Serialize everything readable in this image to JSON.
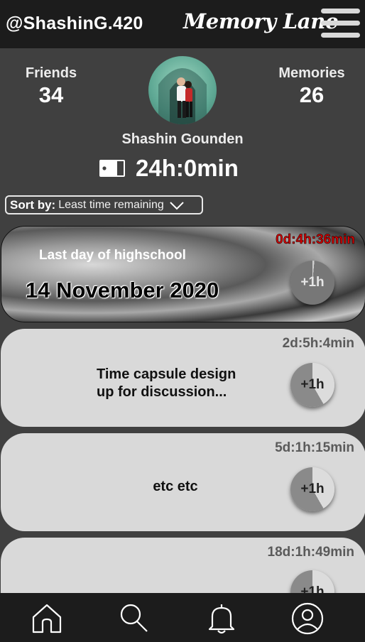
{
  "header": {
    "handle": "@ShashinG.420",
    "app_title": "Memory Lane",
    "menu_icon": "hamburger-menu-icon"
  },
  "profile": {
    "friends_label": "Friends",
    "friends_count": "34",
    "memories_label": "Memories",
    "memories_count": "26",
    "name": "Shashin Gounden",
    "time_balance": "24h:0min",
    "time_icon": "battery-icon"
  },
  "sort": {
    "label": "Sort by:",
    "value": "Least time remaining"
  },
  "memories": [
    {
      "time_left": "0d:4h:36min",
      "title": "Last day of highschool",
      "date": "14 November 2020",
      "add_label": "+1h",
      "time_color": "#d40000"
    },
    {
      "time_left": "2d:5h:4min",
      "title_line1": "Time capsule design",
      "title_line2": "up for discussion...",
      "add_label": "+1h"
    },
    {
      "time_left": "5d:1h:15min",
      "title": "etc etc",
      "add_label": "+1h"
    },
    {
      "time_left": "18d:1h:49min",
      "add_label": "+1h"
    }
  ],
  "nav": {
    "items": [
      "home-icon",
      "search-icon",
      "bell-icon",
      "profile-icon"
    ]
  },
  "colors": {
    "background": "#404040",
    "bar": "#1c1c1c",
    "card": "#d9d9d9",
    "urgent": "#d40000"
  }
}
